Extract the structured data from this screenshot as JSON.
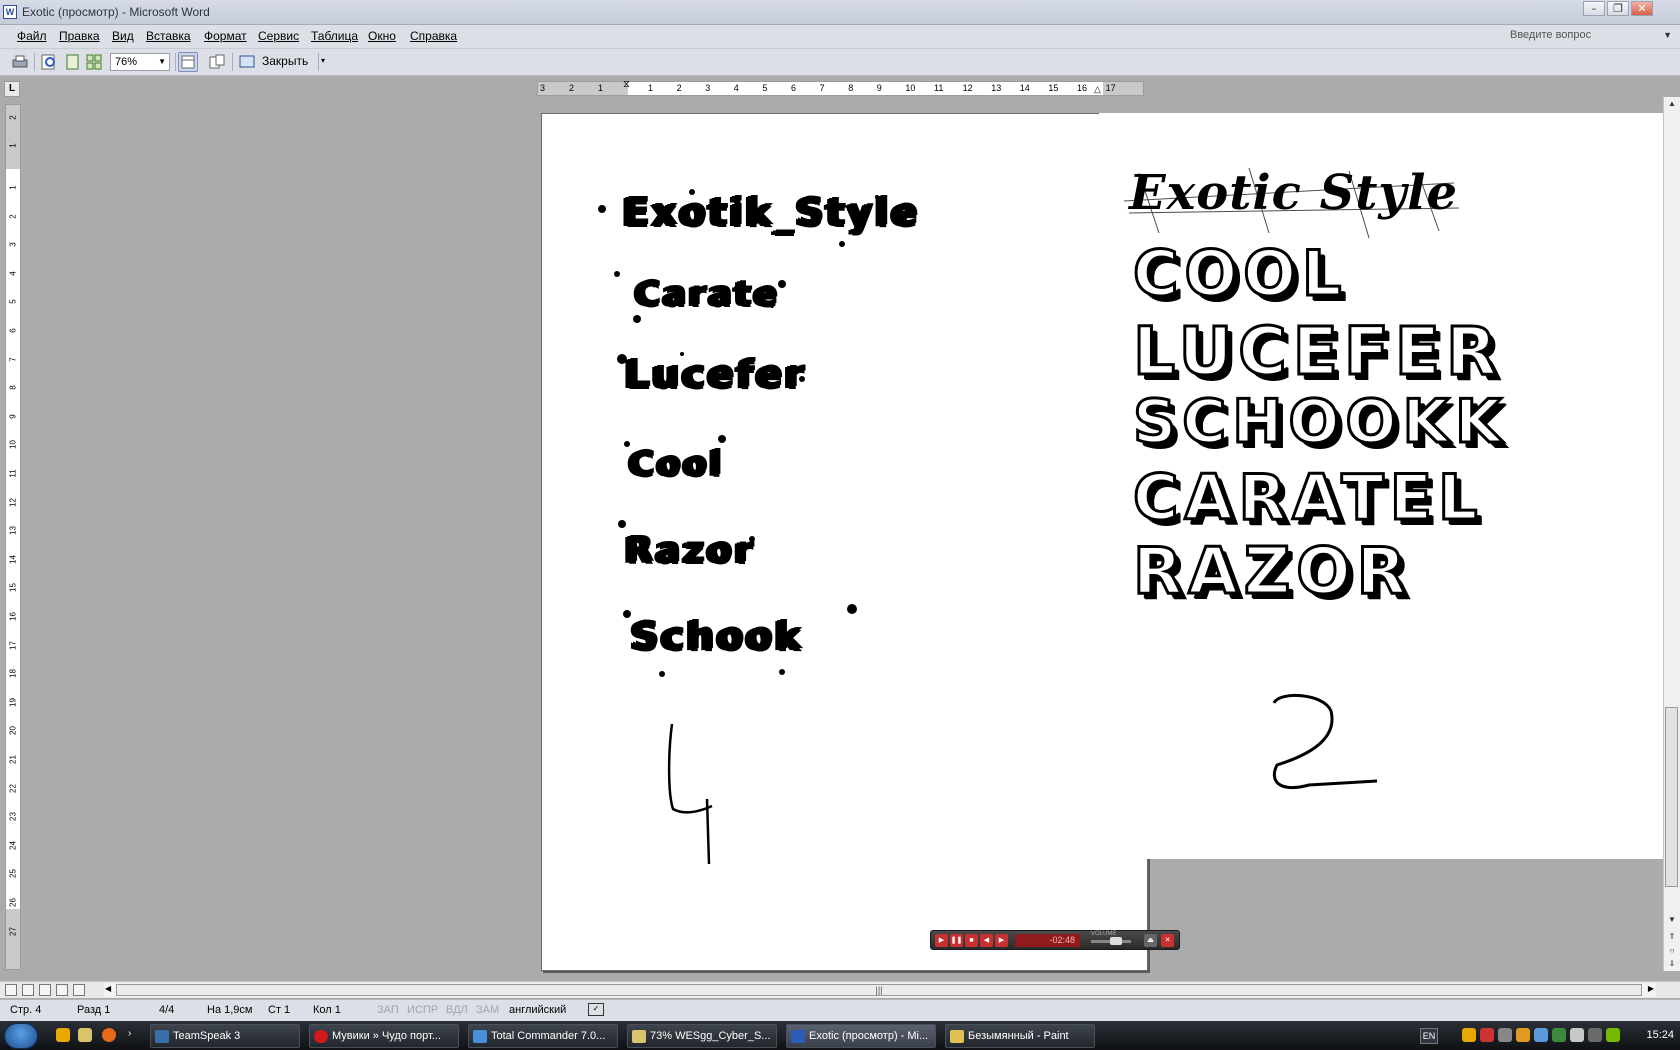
{
  "window": {
    "title": "Exotic (просмотр) - Microsoft Word",
    "app_icon": "W",
    "controls": [
      "minimize-icon",
      "restore-icon",
      "close-icon"
    ]
  },
  "menu": {
    "items": [
      "Файл",
      "Правка",
      "Вид",
      "Вставка",
      "Формат",
      "Сервис",
      "Таблица",
      "Окно",
      "Справка"
    ],
    "ask_placeholder": "Введите вопрос"
  },
  "toolbar": {
    "zoom": "76%",
    "close_label": "Закрыть"
  },
  "ruler": {
    "corner": "L",
    "h_numbers": [
      "3",
      "2",
      "1",
      "1",
      "2",
      "3",
      "4",
      "5",
      "6",
      "7",
      "8",
      "9",
      "10",
      "11",
      "12",
      "13",
      "14",
      "15",
      "16",
      "17"
    ],
    "v_numbers": [
      "2",
      "1",
      "1",
      "2",
      "3",
      "4",
      "5",
      "6",
      "7",
      "8",
      "9",
      "10",
      "11",
      "12",
      "13",
      "14",
      "15",
      "16",
      "17",
      "18",
      "19",
      "20",
      "21",
      "22",
      "23",
      "24",
      "25",
      "26",
      "27"
    ]
  },
  "document": {
    "left_words": [
      "Exotik_Style",
      "Carate",
      "Lucefer",
      "Cool",
      "Razor",
      "Schook"
    ],
    "left_number": "4",
    "right_title": "Exotic Style",
    "right_words": [
      "COOL",
      "LUCEFER",
      "SCHOOKK",
      "CARATEL",
      "RAZOR"
    ],
    "right_number": "2"
  },
  "player": {
    "time": "-02:48",
    "volume_label": "VOLUME",
    "volume_level": 0.55
  },
  "status": {
    "page": "Стр. 4",
    "section": "Разд 1",
    "pages": "4/4",
    "at": "На 1,9см",
    "line": "Ст 1",
    "col": "Кол 1",
    "rec": "ЗАП",
    "trk": "ИСПР",
    "ext": "ВДЛ",
    "ovr": "ЗАМ",
    "lang": "английский"
  },
  "taskbar": {
    "tasks": [
      "TeamSpeak 3",
      "Мувики » Чудо порт...",
      "Total Commander 7.0...",
      "73% WESgg_Cyber_S...",
      "Exotic (просмотр) - Mi...",
      "Безымянный - Paint"
    ],
    "lang": "EN",
    "clock": "15:24"
  },
  "colors": {
    "workspace": "#ababab",
    "chrome": "#dcdfe6",
    "taskbar": "#1a1d22"
  }
}
